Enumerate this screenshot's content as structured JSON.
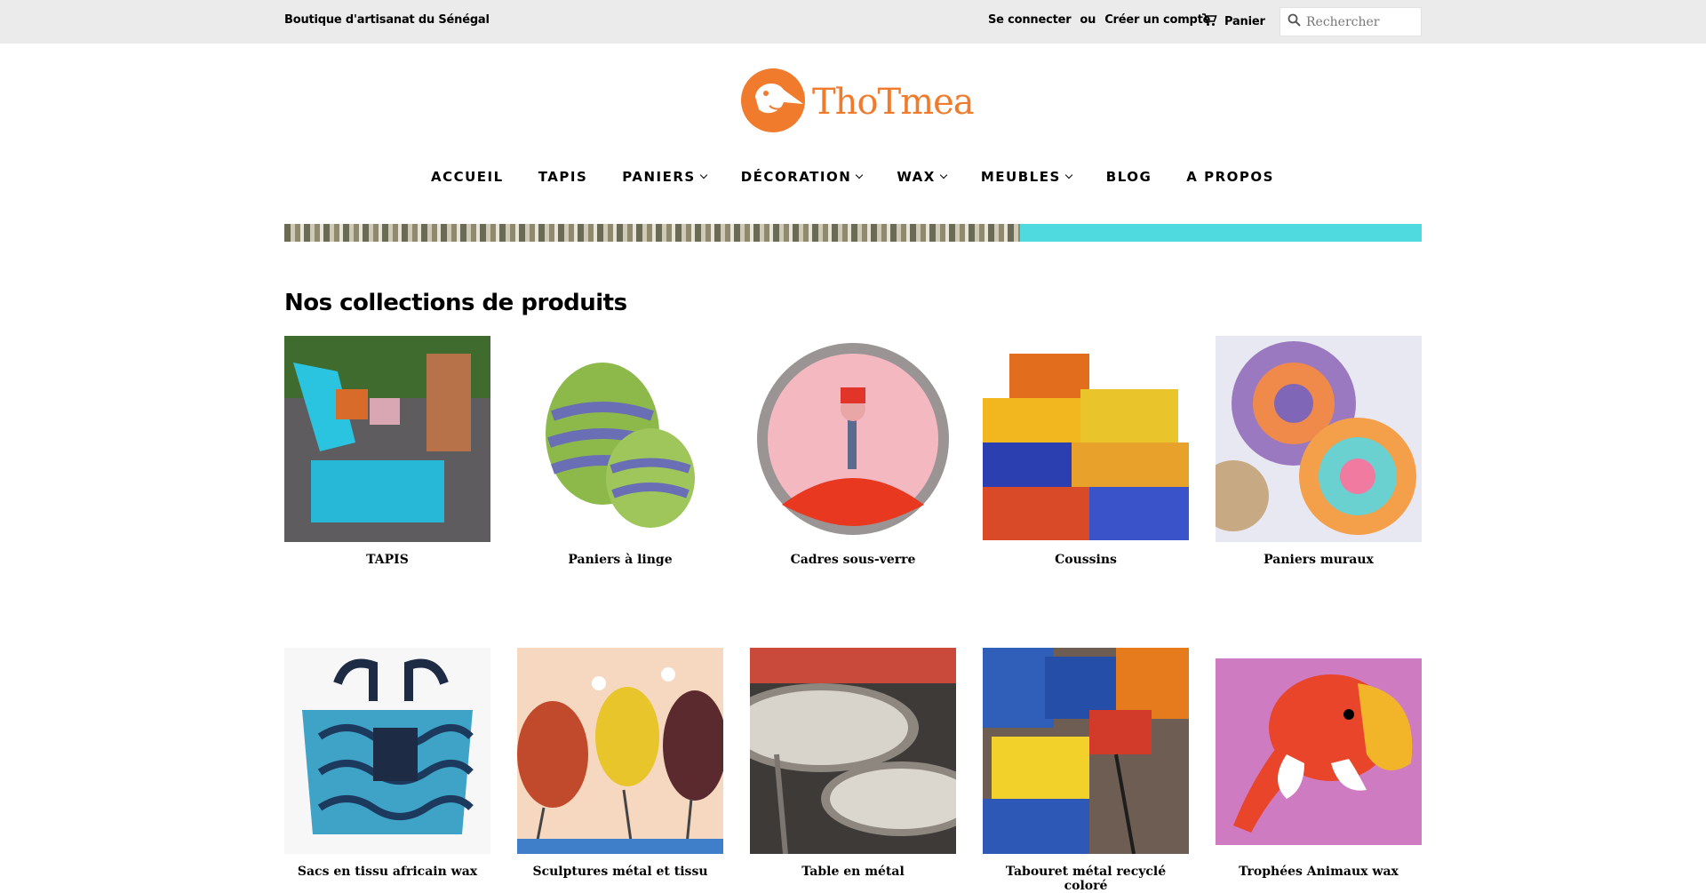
{
  "topbar": {
    "tagline": "Boutique d'artisanat du Sénégal",
    "login": "Se connecter",
    "or": "ou",
    "register": "Créer un compte",
    "cart": "Panier",
    "search_placeholder": "Rechercher"
  },
  "logo": {
    "text": "ThoTmea"
  },
  "nav": {
    "items": [
      {
        "label": "ACCUEIL",
        "dropdown": false
      },
      {
        "label": "TAPIS",
        "dropdown": false
      },
      {
        "label": "PANIERS",
        "dropdown": true
      },
      {
        "label": "DÉCORATION",
        "dropdown": true
      },
      {
        "label": "WAX",
        "dropdown": true
      },
      {
        "label": "MEUBLES",
        "dropdown": true
      },
      {
        "label": "BLOG",
        "dropdown": false
      },
      {
        "label": "A PROPOS",
        "dropdown": false
      }
    ]
  },
  "collections": {
    "title": "Nos collections de produits",
    "items": [
      {
        "label": "TAPIS"
      },
      {
        "label": "Paniers à linge"
      },
      {
        "label": "Cadres sous-verre"
      },
      {
        "label": "Coussins"
      },
      {
        "label": "Paniers muraux"
      },
      {
        "label": "Sacs en tissu africain wax"
      },
      {
        "label": "Sculptures métal et tissu"
      },
      {
        "label": "Table en métal"
      },
      {
        "label": "Tabouret métal recyclé coloré"
      },
      {
        "label": "Trophées Animaux wax"
      }
    ]
  },
  "colors": {
    "topbar_bg": "#ebebeb",
    "brand_orange": "#f07b2c",
    "banner_teal": "#4fdadf"
  }
}
